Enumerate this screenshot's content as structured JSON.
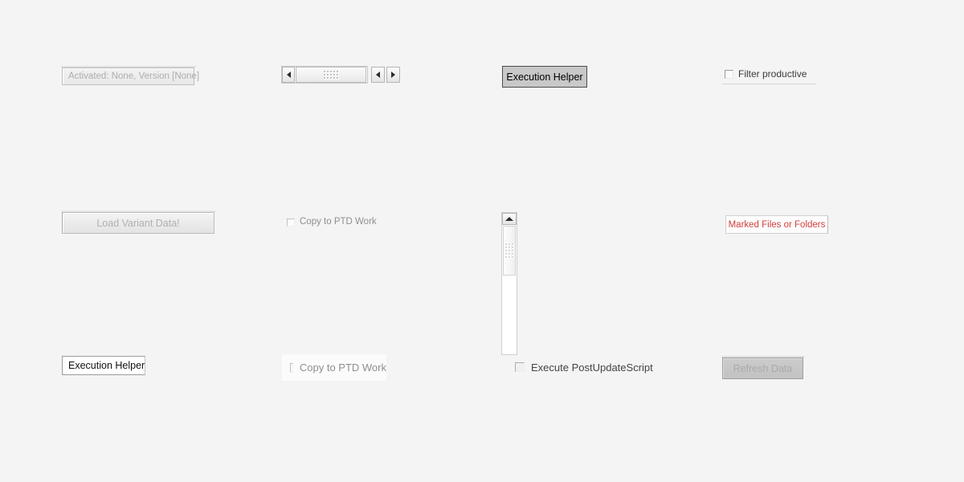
{
  "background_color": "#f4f4f4",
  "widgets": {
    "activated_label": {
      "text": "Activated: None, Version [None]",
      "state": "disabled",
      "text_color": "#adadad"
    },
    "horizontal_scrollbar": {
      "left_arrow_icon": "arrow-left-icon",
      "thumb_grip_icon": "grip-dots-icon",
      "prev_arrow_icon": "arrow-left-icon",
      "next_arrow_icon": "arrow-right-icon"
    },
    "execution_helper_top": {
      "label": "Execution Helper",
      "background_color": "#c8c8c8",
      "border_color": "#4d4d4d"
    },
    "filter_productive": {
      "label": "Filter productive",
      "checked": false,
      "checkbox_icon": "checkbox-unchecked-icon"
    },
    "load_variant_button": {
      "label": "Load Variant Data!",
      "state": "disabled",
      "text_color": "#b0b0b0"
    },
    "copy_to_ptd_work_small": {
      "label": "Copy to PTD Work",
      "checked": false,
      "state": "disabled",
      "checkbox_icon": "checkbox-unchecked-icon"
    },
    "vertical_scrollbar": {
      "up_arrow_icon": "arrow-up-icon",
      "thumb_grip_icon": "grip-dots-icon"
    },
    "marked_files_label": {
      "text": "Marked Files or Folders",
      "text_color": "#d43c3c"
    },
    "execution_helper_bottom": {
      "label": "Execution Helper",
      "background_color": "#ffffff",
      "border_color": "#9c9c9c"
    },
    "copy_to_ptd_work_large": {
      "label": "Copy to PTD Work",
      "checked": false,
      "state": "disabled",
      "checkbox_icon": "checkbox-unchecked-icon"
    },
    "execute_postupdate_script": {
      "label": "Execute PostUpdateScript",
      "checked": false,
      "checkbox_icon": "checkbox-unchecked-icon"
    },
    "refresh_data_button": {
      "label": "Refresh Data",
      "state": "disabled",
      "text_color": "#aaaaaa"
    }
  }
}
